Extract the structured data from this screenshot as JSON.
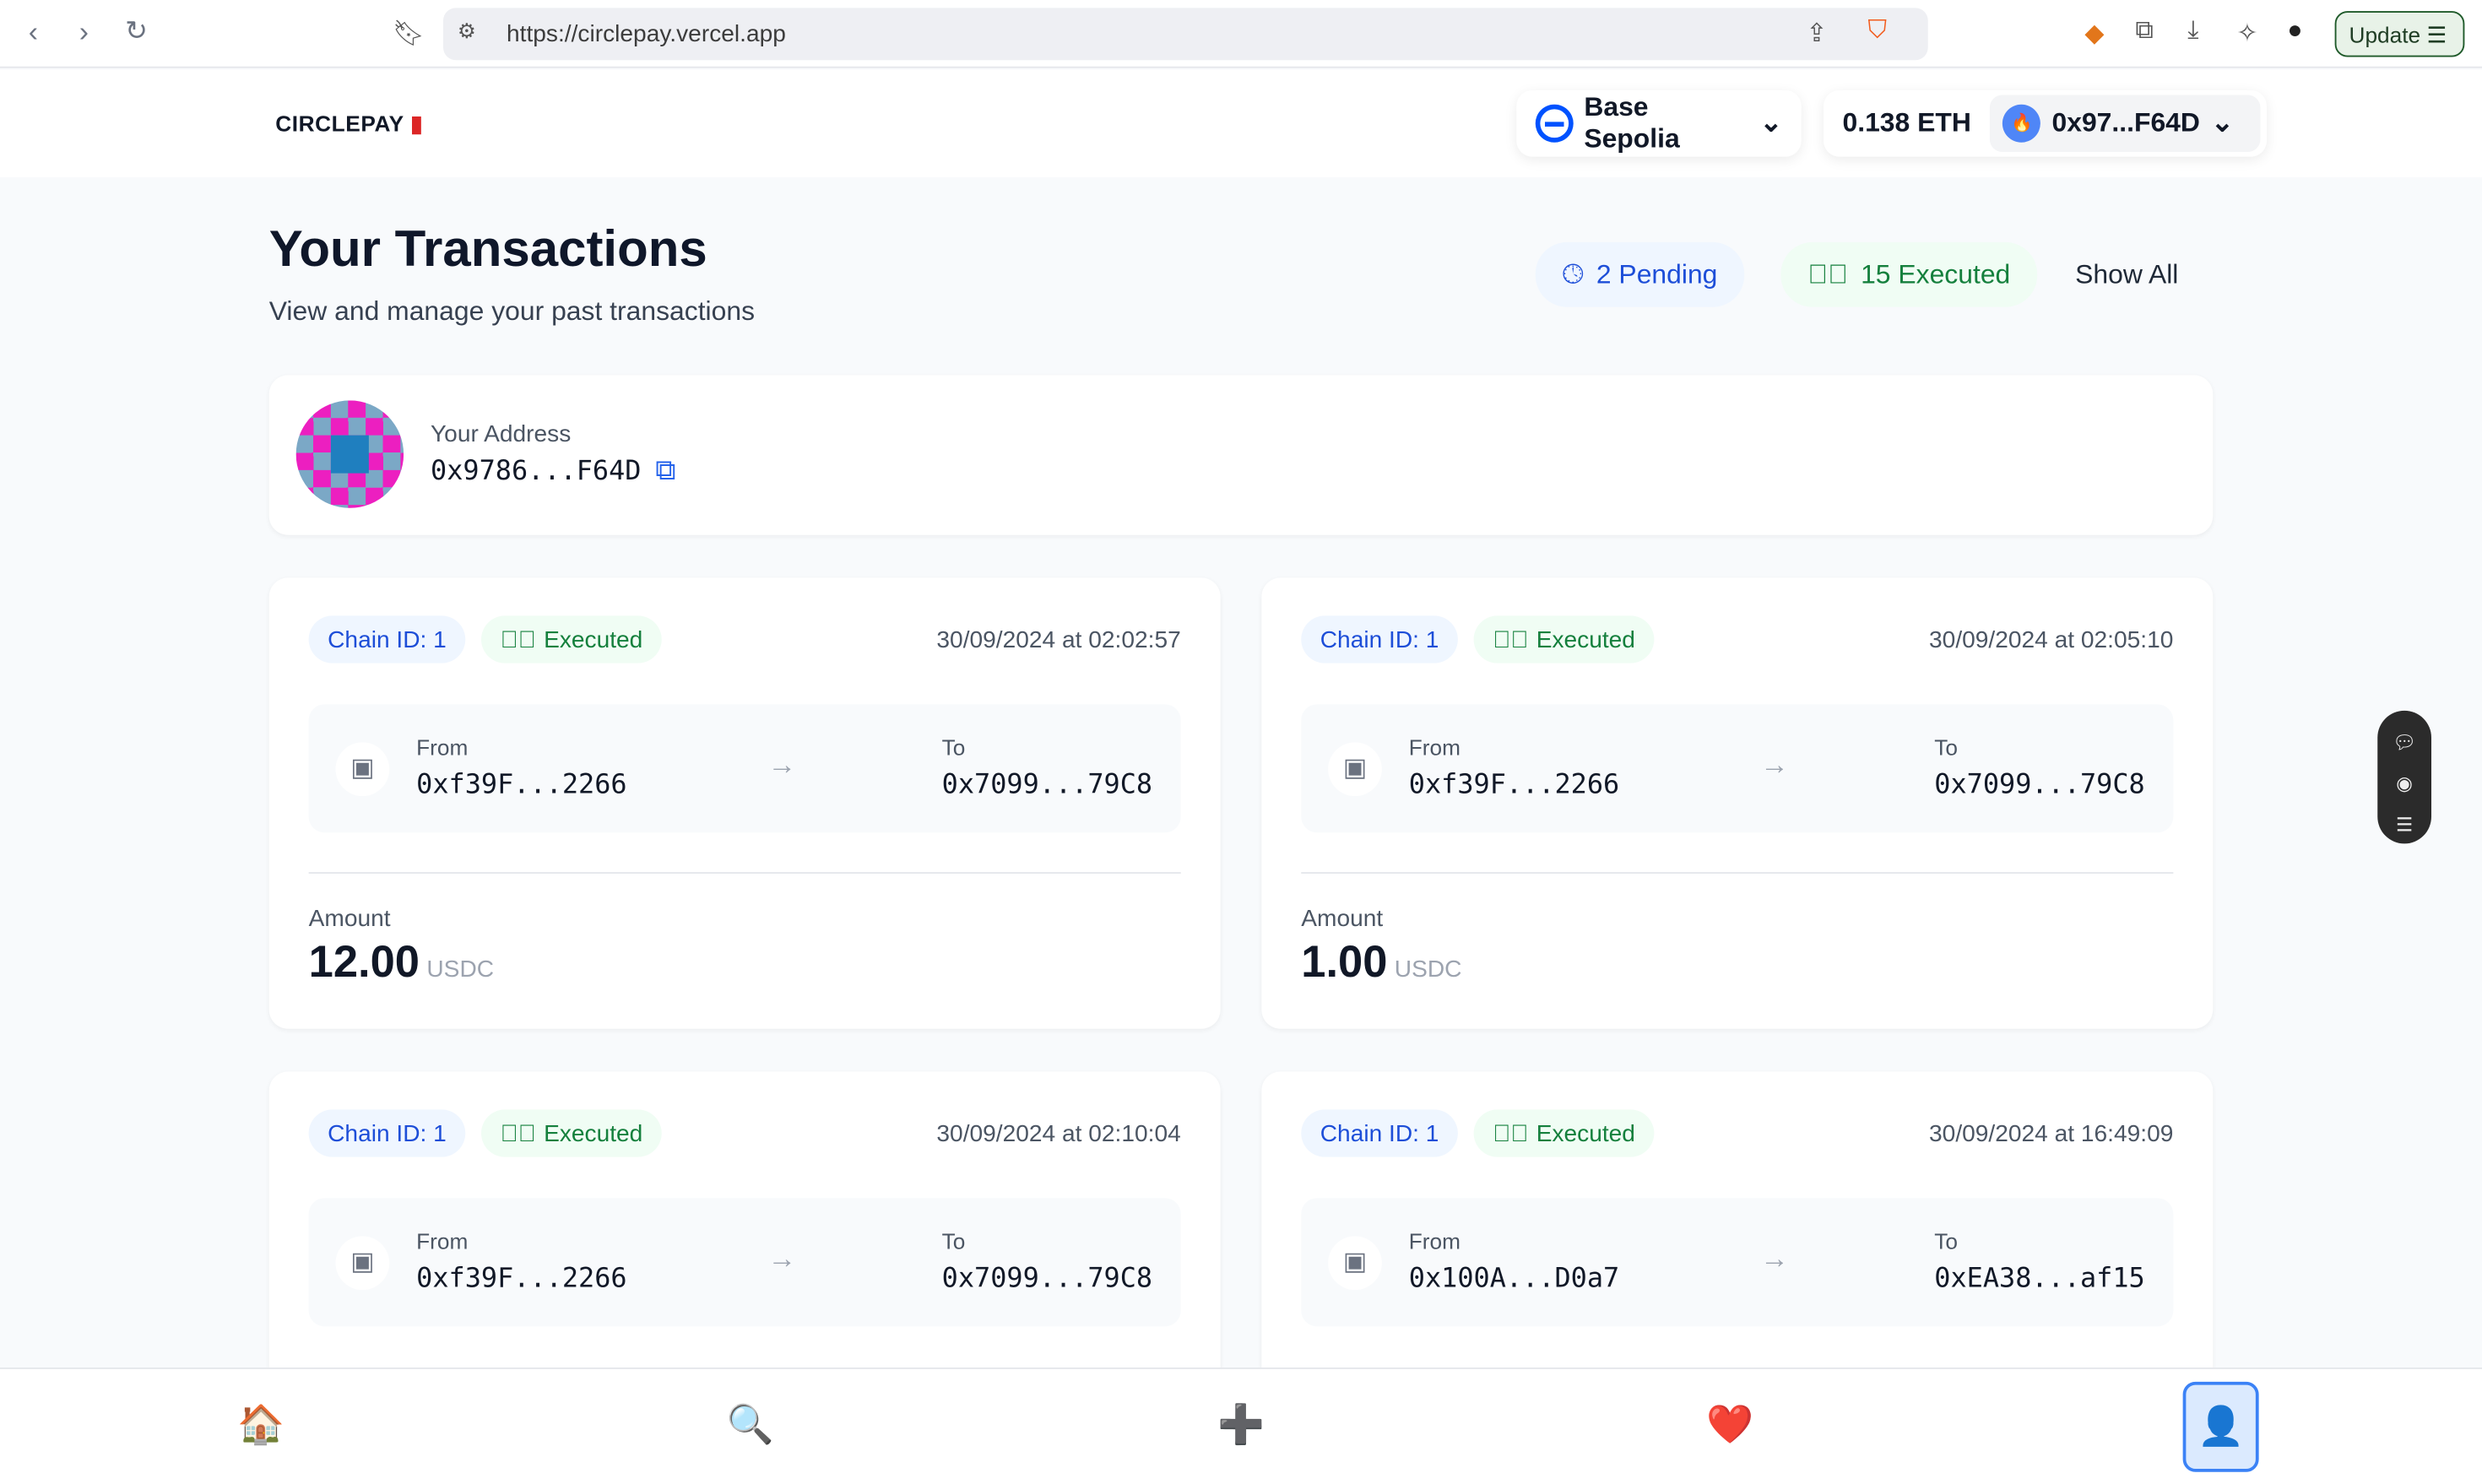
{
  "browser": {
    "url": "https://circlepay.vercel.app",
    "update_label": "Update"
  },
  "header": {
    "logo": "CIRCLEPAY",
    "network": "Base Sepolia",
    "balance": "0.138 ETH",
    "account": "0x97...F64D"
  },
  "page": {
    "title": "Your Transactions",
    "subtitle": "View and manage your past transactions"
  },
  "filters": {
    "pending": "2 Pending",
    "executed": "15 Executed",
    "show_all": "Show All"
  },
  "address": {
    "label": "Your Address",
    "value": "0x9786...F64D"
  },
  "labels": {
    "from": "From",
    "to": "To",
    "amount": "Amount"
  },
  "transactions": [
    {
      "chain": "Chain ID: 1",
      "status": "Executed",
      "date": "30/09/2024 at 02:02:57",
      "from": "0xf39F...2266",
      "to": "0x7099...79C8",
      "amount": "12.00",
      "currency": "USDC"
    },
    {
      "chain": "Chain ID: 1",
      "status": "Executed",
      "date": "30/09/2024 at 02:05:10",
      "from": "0xf39F...2266",
      "to": "0x7099...79C8",
      "amount": "1.00",
      "currency": "USDC"
    },
    {
      "chain": "Chain ID: 1",
      "status": "Executed",
      "date": "30/09/2024 at 02:10:04",
      "from": "0xf39F...2266",
      "to": "0x7099...79C8"
    },
    {
      "chain": "Chain ID: 1",
      "status": "Executed",
      "date": "30/09/2024 at 16:49:09",
      "from": "0x100A...D0a7",
      "to": "0xEA38...af15"
    }
  ],
  "bottom_nav": [
    {
      "icon": "home-icon",
      "glyph": "🏠"
    },
    {
      "icon": "search-icon",
      "glyph": "🔍"
    },
    {
      "icon": "plus-icon",
      "glyph": "➕"
    },
    {
      "icon": "heart-icon",
      "glyph": "❤️"
    },
    {
      "icon": "profile-icon",
      "glyph": "👤"
    }
  ],
  "colors": {
    "accent": "#2563eb",
    "success": "#15803d",
    "chip_blue_bg": "#eff6ff",
    "chip_green_bg": "#f0fdf4"
  }
}
